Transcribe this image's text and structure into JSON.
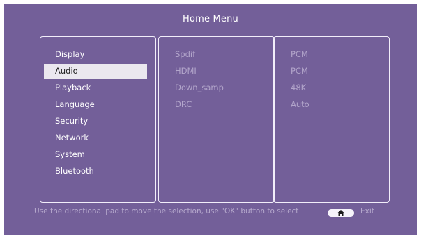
{
  "header": {
    "title": "Home Menu"
  },
  "menu": {
    "items": [
      {
        "label": "Display"
      },
      {
        "label": "Audio",
        "selected": true
      },
      {
        "label": "Playback"
      },
      {
        "label": "Language"
      },
      {
        "label": "Security"
      },
      {
        "label": "Network"
      },
      {
        "label": "System"
      },
      {
        "label": "Bluetooth"
      }
    ]
  },
  "settings": [
    {
      "name": "Spdif",
      "value": "PCM"
    },
    {
      "name": "HDMI",
      "value": "PCM"
    },
    {
      "name": "Down_samp",
      "value": "48K"
    },
    {
      "name": "DRC",
      "value": "Auto"
    }
  ],
  "footer": {
    "hint": "Use the directional pad to move the selection, use \"OK\" button to select",
    "exit_label": "Exit",
    "home_icon": "home-icon"
  },
  "colors": {
    "background": "#735f99",
    "selection": "#ebe8ef",
    "dim_text": "#b3a6cb",
    "border": "#f2eefa"
  }
}
